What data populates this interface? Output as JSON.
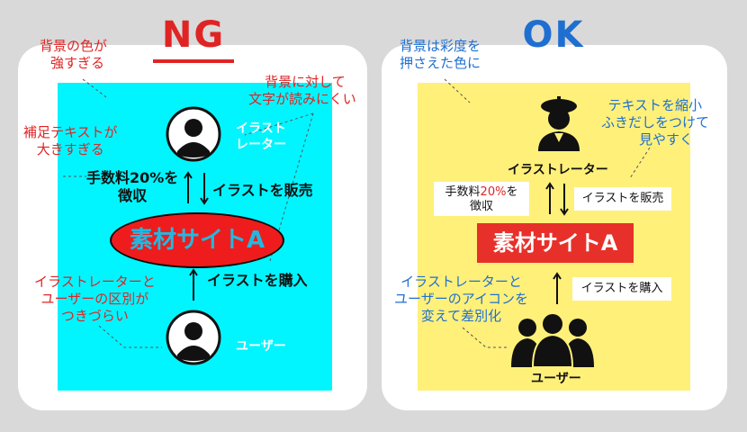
{
  "ng": {
    "heading": "NG",
    "annotations": {
      "bg_strong": [
        "背景の色が",
        "強すぎる"
      ],
      "text_on_bg": [
        "背景に対して",
        "文字が読みにくい"
      ],
      "supp_large": [
        "補足テキストが",
        "大きすぎる"
      ],
      "hard_to_distinguish": [
        "イラストレーターと",
        "ユーザーの区別が",
        "つきづらい"
      ]
    },
    "illustrator_label": [
      "イラスト",
      "レーター"
    ],
    "fee": [
      "手数料20%を",
      "徴収"
    ],
    "sell": "イラストを販売",
    "site": "素材サイトA",
    "buy": "イラストを購入",
    "user_label": "ユーザー"
  },
  "ok": {
    "heading": "OK",
    "annotations": {
      "bg_muted": [
        "背景は彩度を",
        "押さえた色に"
      ],
      "bubble_small": [
        "テキストを縮小",
        "ふきだしをつけて",
        "見やすく"
      ],
      "icon_diff": [
        "イラストレーターと",
        "ユーザーのアイコンを",
        "変えて差別化"
      ]
    },
    "illustrator_label": "イラストレーター",
    "fee_prefix": "手数料",
    "fee_percent": "20%",
    "fee_suffix": "を",
    "fee_line2": "徴収",
    "sell": "イラストを販売",
    "site": "素材サイトA",
    "buy": "イラストを購入",
    "user_label": "ユーザー"
  },
  "colors": {
    "page_bg": "#d9d9d9",
    "ng_accent": "#e02424",
    "ok_accent": "#1f6fd1",
    "ng_box_bg": "#00f5ff",
    "ok_box_bg": "#fff07a",
    "site_red": "#e8302a"
  },
  "icons": [
    "person-avatar-icon",
    "illustrator-beret-icon",
    "user-group-icon",
    "arrow-up-icon",
    "arrow-down-icon"
  ]
}
